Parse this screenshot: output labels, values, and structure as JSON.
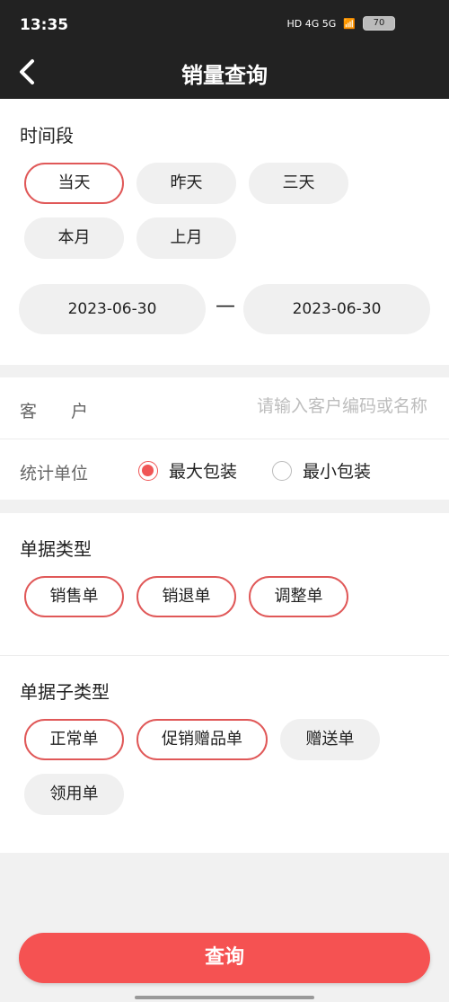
{
  "status_bar": {
    "time": "13:35",
    "signals": "HD 4G 5G",
    "battery": "70"
  },
  "header": {
    "title": "销量查询"
  },
  "time_period": {
    "title": "时间段",
    "chips": [
      {
        "label": "当天",
        "selected": true
      },
      {
        "label": "昨天",
        "selected": false
      },
      {
        "label": "三天",
        "selected": false
      },
      {
        "label": "本月",
        "selected": false
      },
      {
        "label": "上月",
        "selected": false
      }
    ],
    "start_date": "2023-06-30",
    "separator": "—",
    "end_date": "2023-06-30"
  },
  "customer": {
    "label": "客　　户",
    "placeholder": "请输入客户编码或名称",
    "value": ""
  },
  "unit": {
    "label": "统计单位",
    "options": [
      {
        "label": "最大包装",
        "selected": true
      },
      {
        "label": "最小包装",
        "selected": false
      }
    ]
  },
  "doc_type": {
    "title": "单据类型",
    "chips": [
      {
        "label": "销售单",
        "selected": true
      },
      {
        "label": "销退单",
        "selected": true
      },
      {
        "label": "调整单",
        "selected": true
      }
    ]
  },
  "doc_subtype": {
    "title": "单据子类型",
    "chips": [
      {
        "label": "正常单",
        "selected": true
      },
      {
        "label": "促销赠品单",
        "selected": true
      },
      {
        "label": "赠送单",
        "selected": false
      },
      {
        "label": "领用单",
        "selected": false
      }
    ]
  },
  "query_button": {
    "label": "查询"
  },
  "colors": {
    "accent": "#f55252",
    "selected_border": "#e05858",
    "header_bg": "#222222"
  }
}
